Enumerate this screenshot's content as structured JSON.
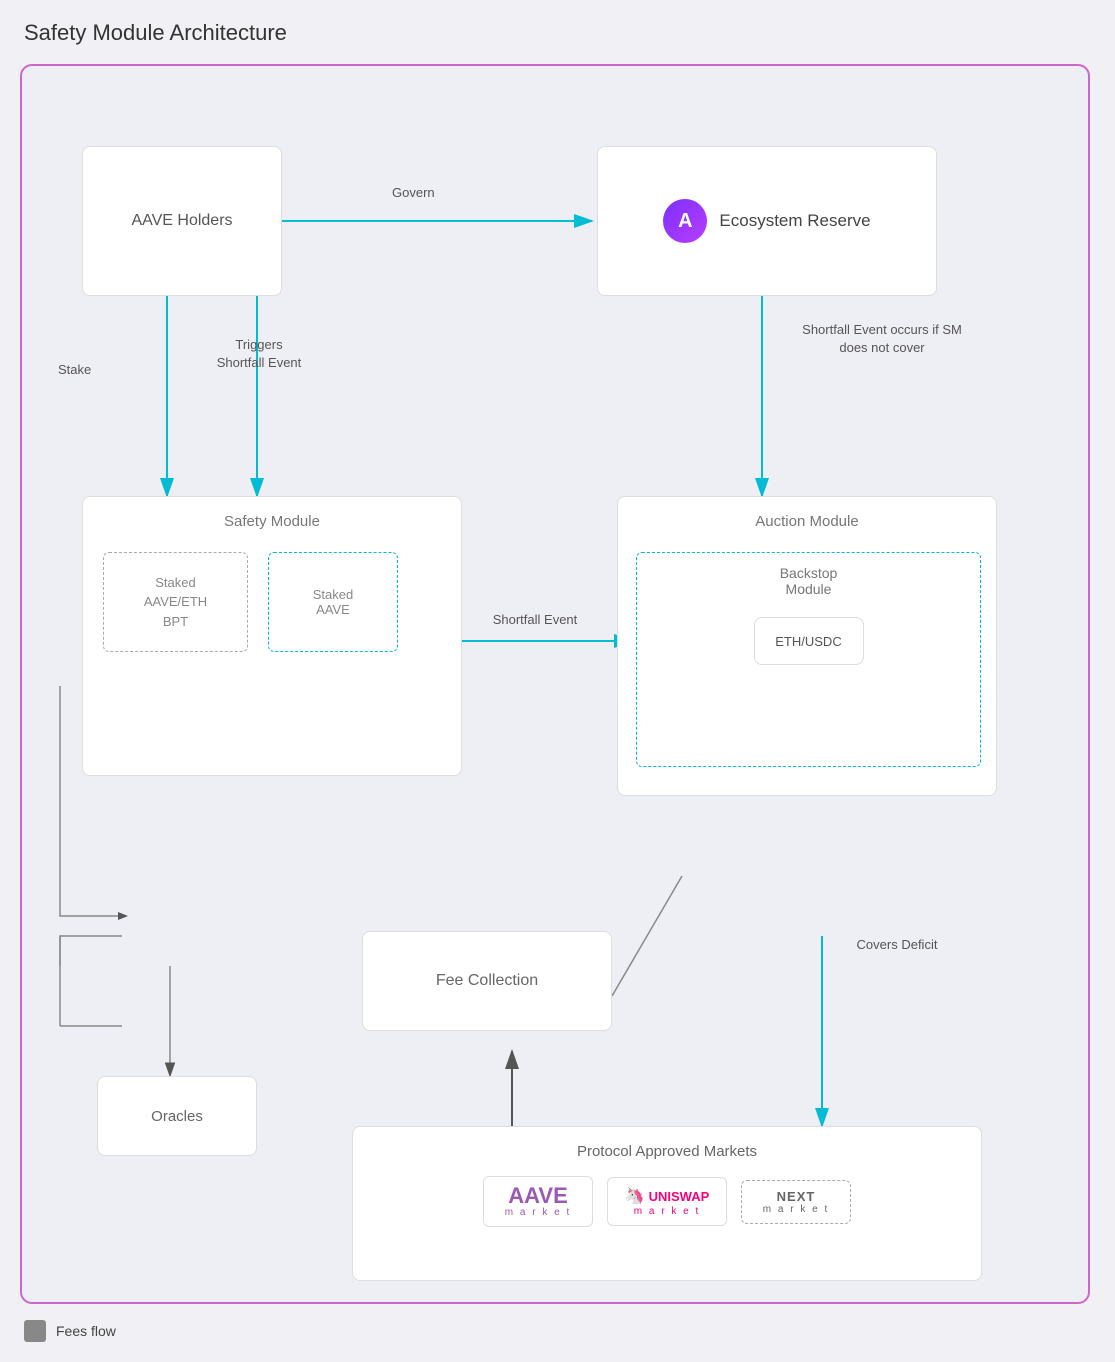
{
  "title": "Safety Module Architecture",
  "legend": {
    "label": "Fees flow"
  },
  "boxes": {
    "aave_holders": "AAVE Holders",
    "ecosystem_reserve": "Ecosystem Reserve",
    "safety_module": "Safety Module",
    "staked_aave_eth": "Staked\nAAVE/ETH\nBPT",
    "staked_aave": "Staked\nAAVE",
    "auction_module": "Auction Module",
    "backstop_module": "Backstop\nModule",
    "eth_usdc": "ETH/USDC",
    "fee_collection": "Fee Collection",
    "protocol_markets": "Protocol Approved Markets",
    "oracles": "Oracles"
  },
  "labels": {
    "govern": "Govern",
    "stake": "Stake",
    "triggers_shortfall": "Triggers\nShortfall\nEvent",
    "shortfall_event_right": "Shortfall Event\noccurs if SM does\nnot cover",
    "shortfall_event_arrow": "Shortfall\nEvent",
    "covers_deficit": "Covers\nDeficit"
  },
  "markets": {
    "aave": {
      "name": "AAVE",
      "sub": "m a r k e t"
    },
    "uniswap": {
      "name": "UNISWAP",
      "sub": "m a r k e t"
    },
    "next": {
      "name": "NEXT",
      "sub": "m a r k e t"
    }
  },
  "colors": {
    "teal": "#00bcd4",
    "dark_arrow": "#555",
    "border_purple": "#cc66cc",
    "aave_gradient_start": "#7b2fff",
    "aave_gradient_end": "#b83eff"
  }
}
